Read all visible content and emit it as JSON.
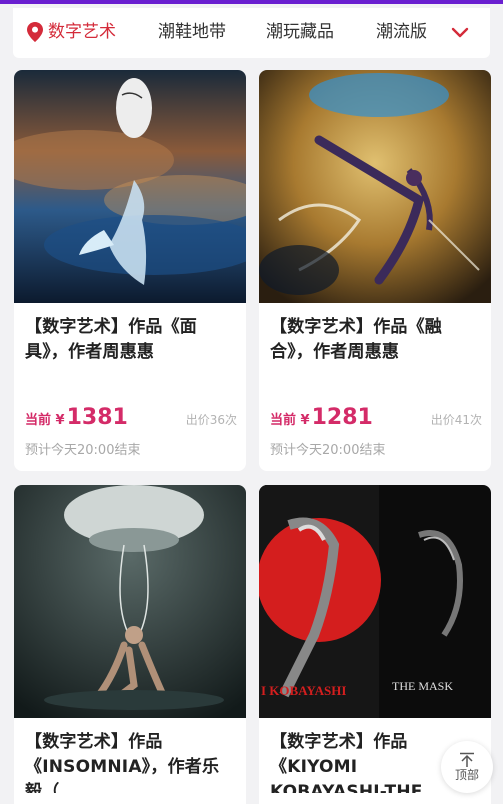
{
  "tabs": [
    {
      "label": "数字艺术",
      "active": true
    },
    {
      "label": "潮鞋地带",
      "active": false
    },
    {
      "label": "潮玩藏品",
      "active": false
    },
    {
      "label": "潮流版",
      "active": false
    }
  ],
  "accent_color": "#d42b3a",
  "price_color": "#d42b68",
  "cards": [
    {
      "title": "【数字艺术】作品《面具》，作者周惠惠",
      "price_prefix": "当前 ¥",
      "price": "1381",
      "bid_count": "出价36次",
      "end_time": "预计今天20:00结束"
    },
    {
      "title": "【数字艺术】作品《融合》，作者周惠惠",
      "price_prefix": "当前 ¥",
      "price": "1281",
      "bid_count": "出价41次",
      "end_time": "预计今天20:00结束"
    },
    {
      "title": "【数字艺术】作品《INSOMNIA》，作者乐毅（...",
      "image_text": ""
    },
    {
      "title": "【数字艺术】作品《KIYOMI KOBAYASHI-THE",
      "image_text": "THE MASK",
      "image_text_2": "I KOBAYASHI"
    }
  ],
  "back_to_top": {
    "label": "顶部"
  }
}
